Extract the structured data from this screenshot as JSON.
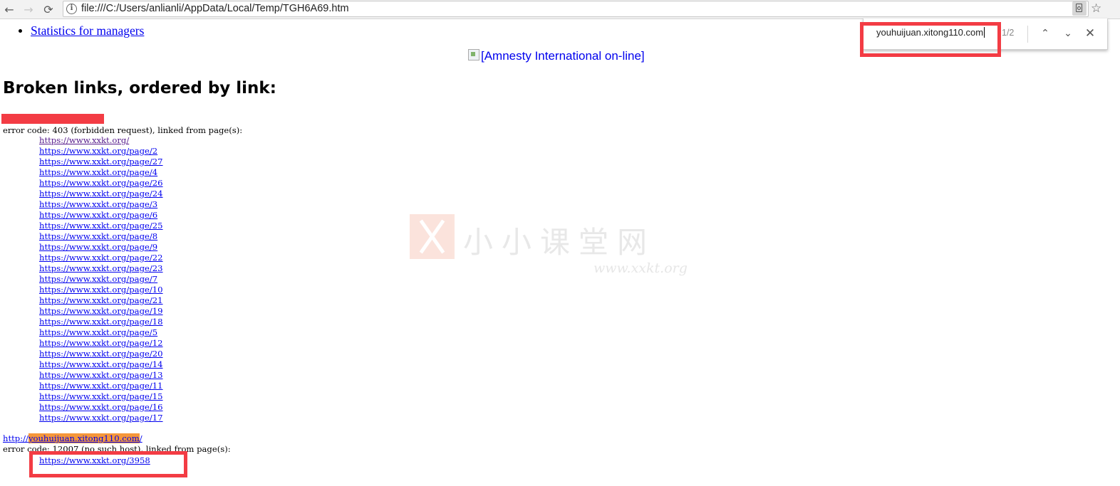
{
  "browser": {
    "back_glyph": "←",
    "forward_glyph": "→",
    "reload_glyph": "⟳",
    "url": "file:///C:/Users/anlianli/AppData/Local/Temp/TGH6A69.htm",
    "star_glyph": "☆"
  },
  "find_bar": {
    "query": "youhuijuan.xitong110.com",
    "count": "1/2",
    "up_glyph": "⌃",
    "down_glyph": "⌄",
    "close_glyph": "✕"
  },
  "page": {
    "nav_link": "Statistics for managers",
    "amnesty_alt": "[Amnesty International on-line]",
    "heading": "Broken links, ordered by link:",
    "section1": {
      "error_text": "error code: 403 (forbidden request), linked from page(s):",
      "links": [
        "https://www.xxkt.org/",
        "https://www.xxkt.org/page/2",
        "https://www.xxkt.org/page/27",
        "https://www.xxkt.org/page/4",
        "https://www.xxkt.org/page/26",
        "https://www.xxkt.org/page/24",
        "https://www.xxkt.org/page/3",
        "https://www.xxkt.org/page/6",
        "https://www.xxkt.org/page/25",
        "https://www.xxkt.org/page/8",
        "https://www.xxkt.org/page/9",
        "https://www.xxkt.org/page/22",
        "https://www.xxkt.org/page/23",
        "https://www.xxkt.org/page/7",
        "https://www.xxkt.org/page/10",
        "https://www.xxkt.org/page/21",
        "https://www.xxkt.org/page/19",
        "https://www.xxkt.org/page/18",
        "https://www.xxkt.org/page/5",
        "https://www.xxkt.org/page/12",
        "https://www.xxkt.org/page/20",
        "https://www.xxkt.org/page/14",
        "https://www.xxkt.org/page/13",
        "https://www.xxkt.org/page/11",
        "https://www.xxkt.org/page/15",
        "https://www.xxkt.org/page/16",
        "https://www.xxkt.org/page/17"
      ]
    },
    "section2": {
      "link_prefix": "http://",
      "link_match": "youhuijuan.xitong110.com",
      "link_suffix": "/",
      "error_text": "error code: 12007 (no such host), linked from page(s):",
      "linked_from": "https://www.xxkt.org/3958"
    }
  },
  "watermark": {
    "text": "小小课堂网",
    "url": "www.xxkt.org"
  },
  "colors": {
    "annotation_red": "#f33c44",
    "find_match_orange": "#f5973a",
    "link_blue": "#0000ee",
    "visited_purple": "#551a8b"
  }
}
